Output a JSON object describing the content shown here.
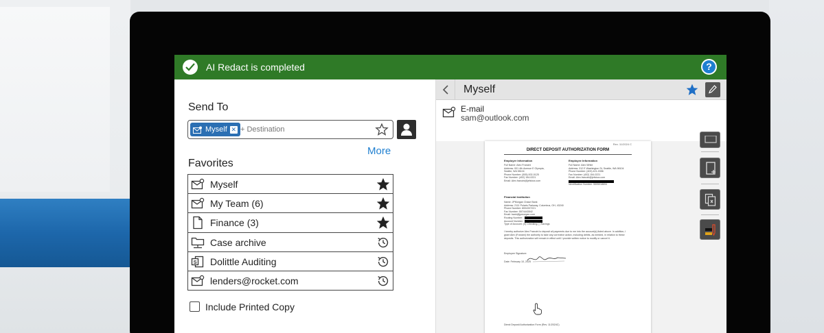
{
  "banner": {
    "message": "AI Redact is completed",
    "help_symbol": "?",
    "color": "#2f7a27"
  },
  "send_to": {
    "label": "Send To",
    "chip_label": "Myself",
    "destination_placeholder": "+ Destination",
    "more_link": "More"
  },
  "favorites": {
    "label": "Favorites",
    "items": [
      {
        "label": "Myself",
        "icon": "envelope-person-icon",
        "action": "star-filled-icon"
      },
      {
        "label": "My Team (6)",
        "icon": "envelope-person-icon",
        "action": "star-filled-icon"
      },
      {
        "label": "Finance (3)",
        "icon": "document-icon",
        "action": "star-filled-icon"
      },
      {
        "label": "Case archive",
        "icon": "network-folder-icon",
        "action": "history-icon"
      },
      {
        "label": "Dolittle Auditing",
        "icon": "sharepoint-icon",
        "action": "history-icon"
      },
      {
        "label": "lenders@rocket.com",
        "icon": "envelope-person-icon",
        "action": "history-icon"
      }
    ]
  },
  "include_printed_copy": {
    "label": "Include Printed Copy",
    "checked": false
  },
  "detail": {
    "title": "Myself",
    "contact_type": "E-mail",
    "email": "sam@outlook.com",
    "accent_color": "#1f6fc6"
  },
  "document": {
    "title": "DIRECT DEPOSIT AUTHORIZATION FORM",
    "tag": "Rev. 11/2024 C",
    "employer_heading": "Employer Information",
    "employer_lines": [
      "Full Name: Aleo Francini",
      "Address: 001 4th Avenue E Olympia,",
      "Seattle, WA 98104",
      "Phone Number: (505) 002-0125",
      "Fax Number: (402) 154-0221",
      "Email: Alex.francini@jefsbox.com"
    ],
    "employee_heading": "Employee Information",
    "employee_lines": [
      "Full Name: Alex White",
      "Address: 312 E Washington St, Seattle, WA 98104",
      "Phone Number: (403) 421-0356",
      "Fax Number: (402) 154-0221",
      "Email: Alex.francini@jefsbox.com",
      "",
      "Identification Number: 5505018694"
    ],
    "financial_heading": "Financial Institution",
    "financial_lines": [
      "Name: JPMorgan Chase Bank",
      "Address: 2111 Polaris Parkway, Columbus, OH, 43240",
      "Phone Number: 8004337221",
      "Fax Number: 5574443542",
      "Email: bank@jpmorgan.com",
      "Routing Number:",
      "Account Number:",
      "Type of Account: (X) Checking ( ) Savings"
    ],
    "authorization": "I hereby authorize Alex Francini to deposit all payments due to me into the account(s) listed above. In addition, I grant Alex (Francini) the authority to take any corrective action, including debits, as needed, in relation to these deposits. This authorization will remain in effect until I provide written notice to modify or cancel it.",
    "signature_label": "Employee Signature:",
    "date_line": "Date: February 10, 2025",
    "footer": "Direct Deposit Authorization Form    (Rev. 11/2024C)"
  },
  "tools": [
    "scan-icon",
    "add-page-icon",
    "copy-pages-icon",
    "redact-marker-icon"
  ]
}
